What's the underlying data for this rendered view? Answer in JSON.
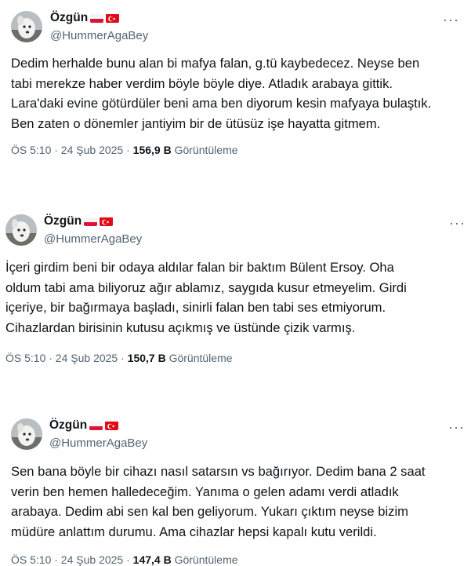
{
  "tweets": [
    {
      "name": "Özgün",
      "handle": "@HummerAgaBey",
      "text": "Dedim herhalde bunu alan bi mafya falan, g.tü kaybedecez. Neyse ben\ntabi merekze haber verdim böyle böyle diye. Atladık arabaya gittik.\nLara'daki evine götürdüler beni ama ben diyorum kesin mafyaya bulaştık.\nBen zaten o dönemler jantiyim bir de ütüsüz işe hayatta gitmem.",
      "time": "ÖS 5:10 · 24 Şub 2025 · ",
      "views": "156,9 B",
      "views_label": " Görüntüleme"
    },
    {
      "name": "Özgün",
      "handle": "@HummerAgaBey",
      "text": "İçeri girdim beni bir odaya aldılar falan bir baktım Bülent Ersoy. Oha\noldum tabi ama biliyoruz ağır ablamız, saygıda kusur etmeyelim. Girdi\niçeriye, bir bağırmaya başladı, sinirli falan ben tabi ses etmiyorum.\nCihazlardan birisinin kutusu açıkmış ve üstünde çizik varmış.",
      "time": "ÖS 5:10 · 24 Şub 2025 · ",
      "views": "150,7 B",
      "views_label": " Görüntüleme"
    },
    {
      "name": "Özgün",
      "handle": "@HummerAgaBey",
      "text": "Sen bana böyle bir cihazı nasıl satarsın vs bağırıyor. Dedim bana 2 saat\nverin ben hemen halledeceğim. Yanıma o gelen adamı verdi atladık\narabaya. Dedim abi sen kal ben geliyorum. Yukarı çıktım neyse bizim\nmüdüre anlattım durumu. Ama cihazlar hepsi kapalı kutu verildi.",
      "time": "ÖS 5:10 · 24 Şub 2025 · ",
      "views": "147,4 B",
      "views_label": " Görüntüleme"
    }
  ],
  "icons": {
    "more": "more-horizontal-icon",
    "flag1": "poland-flag-icon",
    "flag2": "turkey-flag-icon"
  },
  "colors": {
    "text": "#0f1419",
    "secondary": "#536471",
    "separator": "#eff3f4"
  }
}
